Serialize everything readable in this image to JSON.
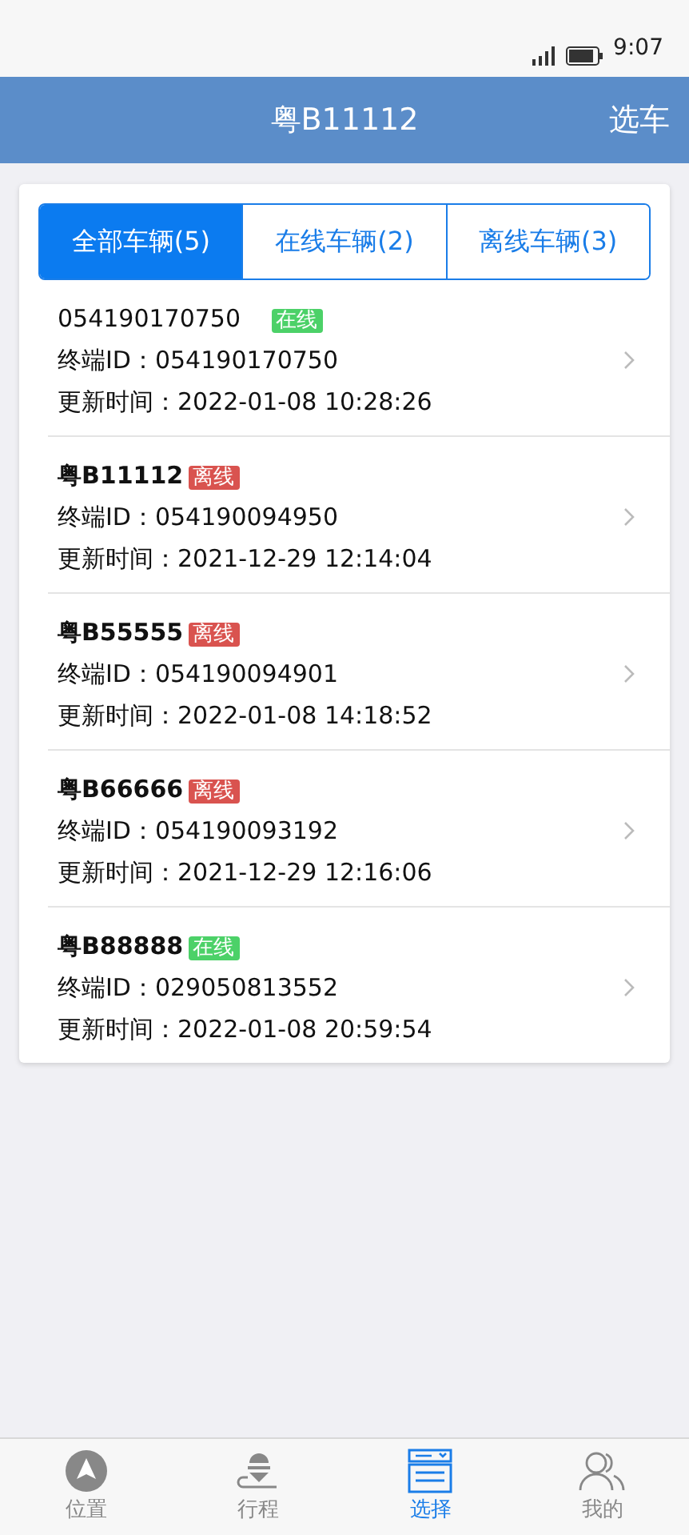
{
  "status_bar": {
    "time": "9:07"
  },
  "header": {
    "title": "粤B11112",
    "action": "选车"
  },
  "tabs": [
    {
      "label": "全部车辆(5)",
      "selected": true
    },
    {
      "label": "在线车辆(2)",
      "selected": false
    },
    {
      "label": "离线车辆(3)",
      "selected": false
    }
  ],
  "vehicles": [
    {
      "name": "054190170750",
      "emphasized": false,
      "status": "在线",
      "online": true,
      "terminal": "终端ID：054190170750",
      "updated": "更新时间：2022-01-08 10:28:26"
    },
    {
      "name": "粤B11112",
      "emphasized": true,
      "status": "离线",
      "online": false,
      "terminal": "终端ID：054190094950",
      "updated": "更新时间：2021-12-29 12:14:04"
    },
    {
      "name": "粤B55555",
      "emphasized": true,
      "status": "离线",
      "online": false,
      "terminal": "终端ID：054190094901",
      "updated": "更新时间：2022-01-08 14:18:52"
    },
    {
      "name": "粤B66666",
      "emphasized": true,
      "status": "离线",
      "online": false,
      "terminal": "终端ID：054190093192",
      "updated": "更新时间：2021-12-29 12:16:06"
    },
    {
      "name": "粤B88888",
      "emphasized": true,
      "status": "在线",
      "online": true,
      "terminal": "终端ID：029050813552",
      "updated": "更新时间：2022-01-08 20:59:54"
    }
  ],
  "bottom_nav": [
    {
      "label": "位置",
      "kind": "location",
      "selected": false
    },
    {
      "label": "行程",
      "kind": "trip",
      "selected": false
    },
    {
      "label": "选择",
      "kind": "list",
      "selected": true
    },
    {
      "label": "我的",
      "kind": "user",
      "selected": false
    }
  ]
}
